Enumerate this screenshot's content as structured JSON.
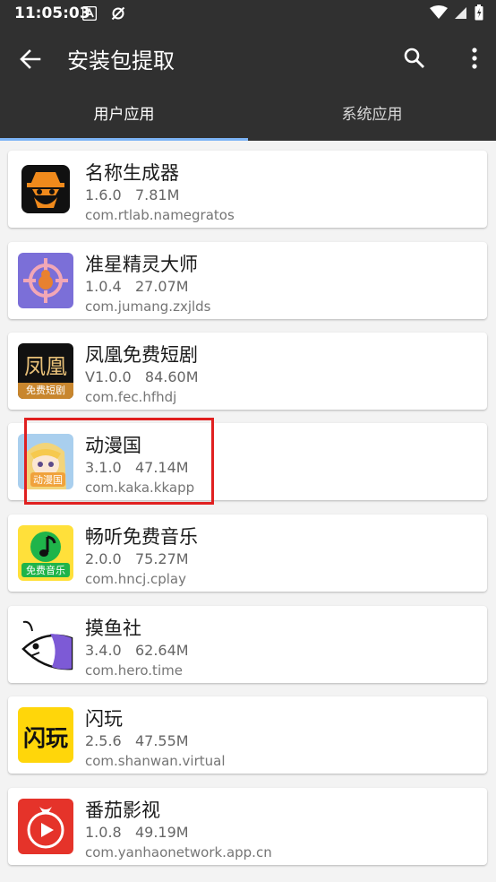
{
  "status": {
    "time": "11:05:03"
  },
  "appbar": {
    "title": "安装包提取"
  },
  "tabs": [
    {
      "label": "用户应用",
      "active": true
    },
    {
      "label": "系统应用",
      "active": false
    }
  ],
  "apps": [
    {
      "name": "名称生成器",
      "version": "1.6.0",
      "size": "7.81M",
      "package": "com.rtlab.namegratos",
      "icon": "spy-icon"
    },
    {
      "name": "准星精灵大师",
      "version": "1.0.4",
      "size": "27.07M",
      "package": "com.jumang.zxjlds",
      "icon": "crosshair-icon"
    },
    {
      "name": "凤凰免费短剧",
      "version": "V1.0.0",
      "size": "84.60M",
      "package": "com.fec.hfhdj",
      "icon": "phoenix-drama-icon"
    },
    {
      "name": "动漫国",
      "version": "3.1.0",
      "size": "47.14M",
      "package": "com.kaka.kkapp",
      "icon": "anime-girl-icon"
    },
    {
      "name": "畅听免费音乐",
      "version": "2.0.0",
      "size": "75.27M",
      "package": "com.hncj.cplay",
      "icon": "music-note-icon"
    },
    {
      "name": "摸鱼社",
      "version": "3.4.0",
      "size": "62.64M",
      "package": "com.hero.time",
      "icon": "fish-icon"
    },
    {
      "name": "闪玩",
      "version": "2.5.6",
      "size": "47.55M",
      "package": "com.shanwan.virtual",
      "icon": "shanwan-icon"
    },
    {
      "name": "番茄影视",
      "version": "1.0.8",
      "size": "49.19M",
      "package": "com.yanhaonetwork.app.cn",
      "icon": "tomato-play-icon"
    }
  ],
  "icon_text": {
    "phoenix_top": "凤凰",
    "phoenix_bottom": "免费短剧",
    "anime_label": "动漫国",
    "music_label": "免费音乐",
    "shanwan": "闪玩"
  },
  "colors": {
    "appbar": "#303030",
    "indicator": "#7cb3f5",
    "highlight": "#e02020",
    "shanwan_yellow": "#ffd60a",
    "tomato_red": "#e5332a",
    "crosshair_purple": "#7b6fd8"
  }
}
